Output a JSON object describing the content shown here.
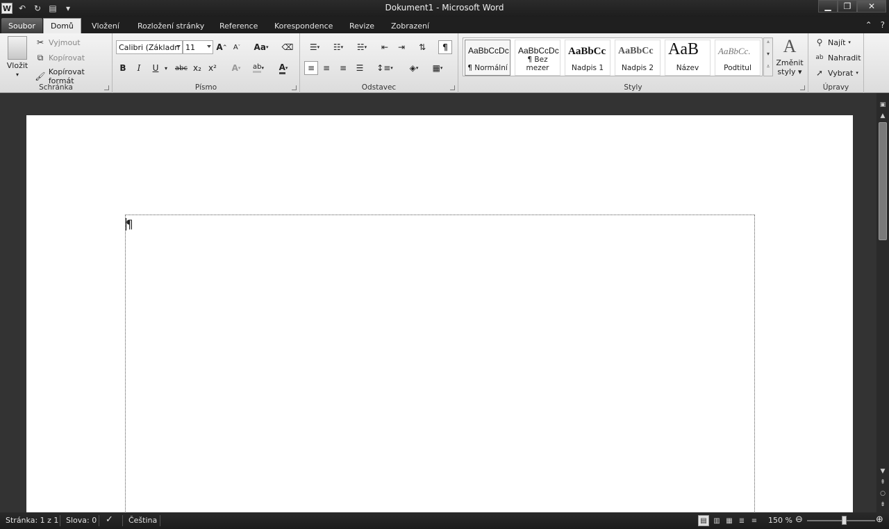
{
  "titlebar": {
    "title": "Dokument1  -  Microsoft Word",
    "logo": "W"
  },
  "tabs": [
    "Soubor",
    "Domů",
    "Vložení",
    "Rozložení stránky",
    "Reference",
    "Korespondence",
    "Revize",
    "Zobrazení"
  ],
  "active_tab": "Domů",
  "clipboard": {
    "paste": "Vložit",
    "cut": "Vyjmout",
    "copy": "Kopírovat",
    "format_painter": "Kopírovat formát",
    "group": "Schránka"
  },
  "font": {
    "name": "Calibri (Základn",
    "size": "11",
    "group": "Písmo",
    "bold": "B",
    "italic": "I",
    "underline": "U",
    "strike": "abc",
    "subscript": "x₂",
    "superscript": "x²",
    "grow": "A",
    "shrink": "A",
    "case": "Aa"
  },
  "paragraph": {
    "group": "Odstavec",
    "show_marks": "¶"
  },
  "styles": {
    "group": "Styly",
    "items": [
      {
        "sample": "AaBbCcDc",
        "name": "¶ Normální"
      },
      {
        "sample": "AaBbCcDc",
        "name": "¶ Bez mezer"
      },
      {
        "sample": "AaBbCc",
        "name": "Nadpis 1"
      },
      {
        "sample": "AaBbCc",
        "name": "Nadpis 2"
      },
      {
        "sample": "AaB",
        "name": "Název"
      },
      {
        "sample": "AaBbCc.",
        "name": "Podtitul"
      }
    ],
    "change": "Změnit",
    "change2": "styly"
  },
  "editing": {
    "group": "Úpravy",
    "find": "Najít",
    "replace": "Nahradit",
    "select": "Vybrat"
  },
  "document": {
    "pilcrow": "¶"
  },
  "statusbar": {
    "page": "Stránka: 1 z 1",
    "words": "Slova: 0",
    "language": "Čeština",
    "zoom": "150 %"
  }
}
